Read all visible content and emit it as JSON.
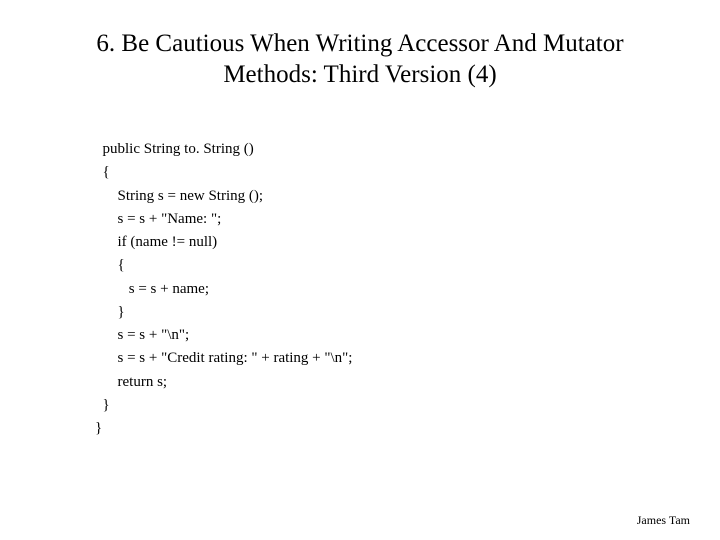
{
  "title_line1": "6. Be Cautious When Writing Accessor And Mutator",
  "title_line2": "Methods: Third Version (4)",
  "code": "  public String to. String ()\n  {\n      String s = new String ();\n      s = s + \"Name: \";\n      if (name != null)\n      {\n         s = s + name;\n      }\n      s = s + \"\\n\";\n      s = s + \"Credit rating: \" + rating + \"\\n\";\n      return s;\n  }\n}",
  "footer": "James Tam"
}
